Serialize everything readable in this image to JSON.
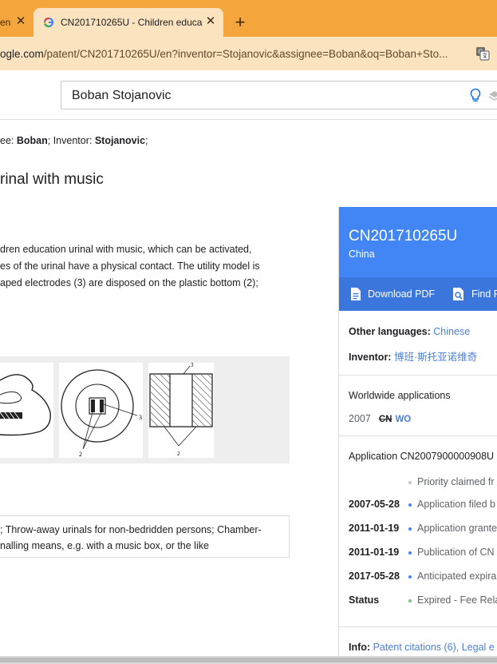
{
  "browser": {
    "tabs": [
      {
        "title": "en",
        "active": false
      },
      {
        "title": "CN201710265U - Children educa",
        "active": true
      }
    ],
    "new_tab_label": "+",
    "close_glyph": "✕",
    "url_domain": "ogle.com",
    "url_path": "/patent/CN201710265U/en?inventor=Stojanovic&assignee=Boban&oq=Boban+Sto..."
  },
  "search": {
    "value": "Boban Stojanovic"
  },
  "query": {
    "assignee_prefix": "ee: ",
    "assignee": "Boban",
    "inventor_prefix": ";  Inventor: ",
    "inventor": "Stojanovic",
    "suffix": ";"
  },
  "page_title": "rinal with music",
  "abstract_lines": [
    "dren education urinal with music, which can be activated,",
    "es of the urinal have a physical contact. The utility model is",
    "aped electrodes (3) are disposed on the plastic bottom (2);"
  ],
  "figures": {
    "labels": [
      "3",
      "2",
      "3",
      "2"
    ]
  },
  "classification_lines": [
    "; Throw-away urinals for non-bedridden persons; Chamber-",
    "nalling means, e.g. with a music box, or the like"
  ],
  "panel": {
    "pub_number": "CN201710265U",
    "country": "China",
    "download_label": "Download PDF",
    "find_label": "Find P",
    "other_languages_label": "Other languages:",
    "other_languages_value": "Chinese",
    "inventor_label": "Inventor:",
    "inventor_value": "博班·斯托亚诺维奇",
    "worldwide_label": "Worldwide applications",
    "ww_year": "2007",
    "ww_cn": "CN",
    "ww_wo": "WO",
    "application_label": "Application CN2007900000908U",
    "events": [
      {
        "date": "",
        "label": "Priority claimed fr",
        "dot": "grey"
      },
      {
        "date": "2007-05-28",
        "label": "Application filed b",
        "dot": "blue"
      },
      {
        "date": "2011-01-19",
        "label": "Application grante",
        "dot": "blue"
      },
      {
        "date": "2011-01-19",
        "label": "Publication of CN",
        "dot": "blue"
      },
      {
        "date": "2017-05-28",
        "label": "Anticipated expira",
        "dot": "blue"
      },
      {
        "date": "Status",
        "label": "Expired - Fee Rela",
        "dot": "green"
      }
    ],
    "info_label": "Info:",
    "info_value": "Patent citations (6), Legal e"
  },
  "colors": {
    "tabbar": "#f4a63c",
    "toolbar": "#fbe3c0",
    "panel_blue": "#4285f4",
    "link": "#4a80d6"
  }
}
